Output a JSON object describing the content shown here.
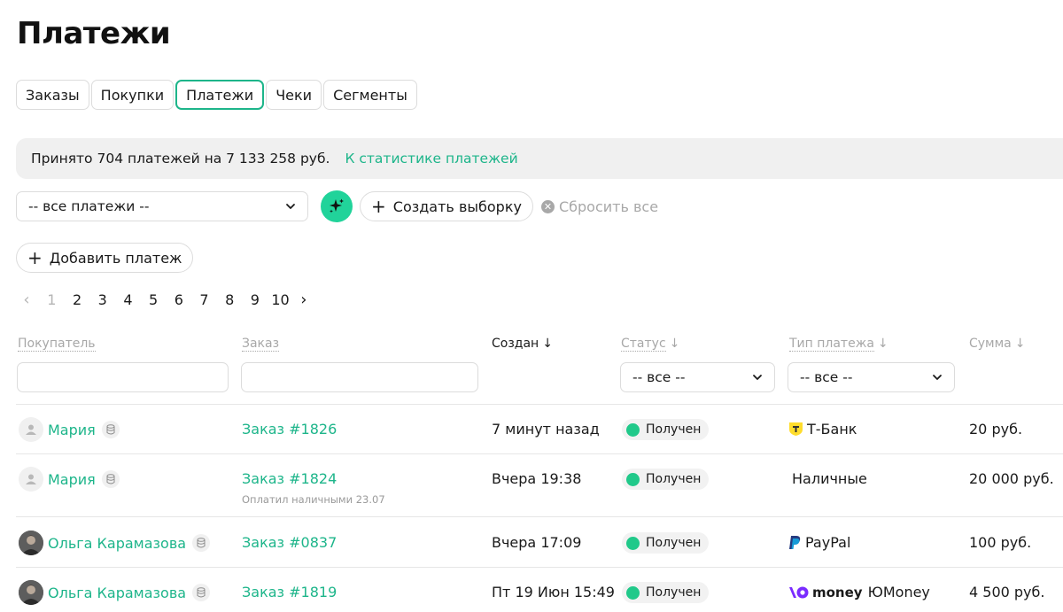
{
  "page": {
    "title": "Платежи"
  },
  "tabs": [
    "Заказы",
    "Покупки",
    "Платежи",
    "Чеки",
    "Сегменты"
  ],
  "active_tab": "Платежи",
  "summary": {
    "text": "Принято 704 платежей на 7 133 258 руб.",
    "link": "К статистике платежей"
  },
  "filters": {
    "payments_select": "-- все платежи --",
    "create_selection": "Создать выборку",
    "reset_all": "Сбросить все"
  },
  "add_payment": "Добавить платеж",
  "pagination": {
    "prev": "‹",
    "pages": [
      "1",
      "2",
      "3",
      "4",
      "5",
      "6",
      "7",
      "8",
      "9",
      "10"
    ],
    "current": "1",
    "next": "›"
  },
  "columns": {
    "buyer": "Покупатель",
    "order": "Заказ",
    "created": "Создан",
    "status": "Статус",
    "payment_type": "Тип платежа",
    "sum": "Сумма",
    "sort_arrow": "↓"
  },
  "column_filters": {
    "status": "-- все --",
    "payment_type": "-- все --"
  },
  "rows": [
    {
      "buyer": "Мария",
      "order": "Заказ #1826",
      "order_note": "",
      "created": "7 минут назад",
      "status": "Получен",
      "payment_type": "Т-Банк",
      "sum": "20 руб."
    },
    {
      "buyer": "Мария",
      "order": "Заказ #1824",
      "order_note": "Оплатил наличными 23.07",
      "created": "Вчера 19:38",
      "status": "Получен",
      "payment_type": "Наличные",
      "sum": "20 000 руб."
    },
    {
      "buyer": "Ольга Карамазова",
      "order": "Заказ #0837",
      "order_note": "",
      "created": "Вчера 17:09",
      "status": "Получен",
      "payment_type": "PayPal",
      "sum": "100 руб."
    },
    {
      "buyer": "Ольга Карамазова",
      "order": "Заказ #1819",
      "order_note": "",
      "created": "Пт 19 Июн 15:49",
      "status": "Получен",
      "payment_type": "ЮMoney",
      "payment_type_logo": "money",
      "sum": "4 500 руб."
    }
  ],
  "colors": {
    "accent": "#1db58a",
    "status_ok": "#21c98a",
    "yoomoney": "#7a2bff",
    "tbank": "#ffdd2d"
  }
}
